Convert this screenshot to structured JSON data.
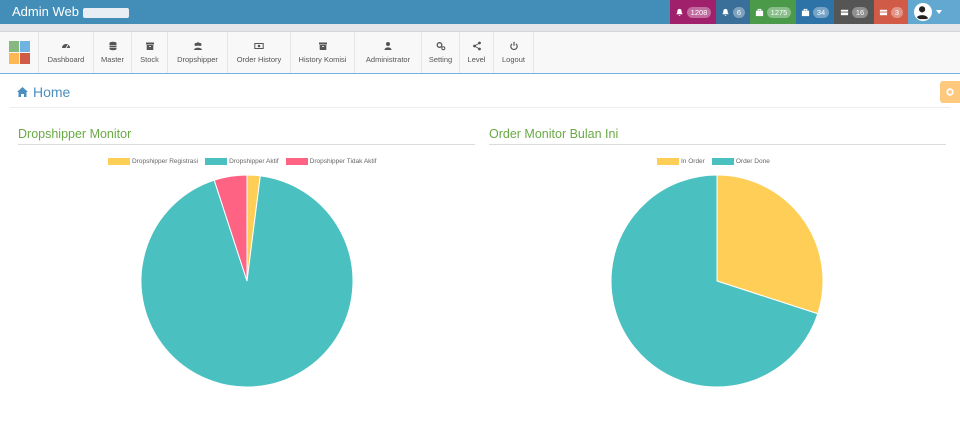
{
  "app": {
    "title": "Admin Web"
  },
  "notifications": [
    {
      "name": "notif-bell-alerts",
      "icon": "bell-icon",
      "count": "1208",
      "color": "#a0206c"
    },
    {
      "name": "notif-bell",
      "icon": "bell-icon",
      "count": "6",
      "color": "#3a6f9a"
    },
    {
      "name": "notif-briefcase-green",
      "icon": "briefcase-icon",
      "count": "1275",
      "color": "#4a9a4a"
    },
    {
      "name": "notif-briefcase",
      "icon": "briefcase-icon",
      "count": "34",
      "color": "#2e73a8"
    },
    {
      "name": "notif-card",
      "icon": "card-icon",
      "count": "16",
      "color": "#555555"
    },
    {
      "name": "notif-card-red",
      "icon": "card-icon",
      "count": "3",
      "color": "#d15b47"
    }
  ],
  "menu": [
    {
      "label": "Dashboard",
      "icon": "tachometer-icon"
    },
    {
      "label": "Master",
      "icon": "database-icon"
    },
    {
      "label": "Stock",
      "icon": "archive-icon"
    },
    {
      "label": "Dropshipper",
      "icon": "users-icon"
    },
    {
      "label": "Order History",
      "icon": "money-icon"
    },
    {
      "label": "History Komisi",
      "icon": "archive-icon"
    },
    {
      "label": "Administrator",
      "icon": "user-icon"
    },
    {
      "label": "Setting",
      "icon": "cogs-icon"
    },
    {
      "label": "Level",
      "icon": "share-icon"
    },
    {
      "label": "Logout",
      "icon": "power-icon"
    }
  ],
  "breadcrumb": {
    "label": "Home"
  },
  "colors": {
    "yellow": "#ffce56",
    "teal": "#4bc0c0",
    "pink": "#ff6384"
  },
  "chart_data": [
    {
      "type": "pie",
      "title": "Dropshipper Monitor",
      "legend_position": "top",
      "categories": [
        "Dropshipper Registrasi",
        "Dropshipper Aktif",
        "Dropshipper Tidak Aktif"
      ],
      "values": [
        2,
        93,
        5
      ]
    },
    {
      "type": "pie",
      "title": "Order Monitor Bulan Ini",
      "legend_position": "top",
      "categories": [
        "In Order",
        "Order Done"
      ],
      "values": [
        30,
        70
      ]
    }
  ]
}
